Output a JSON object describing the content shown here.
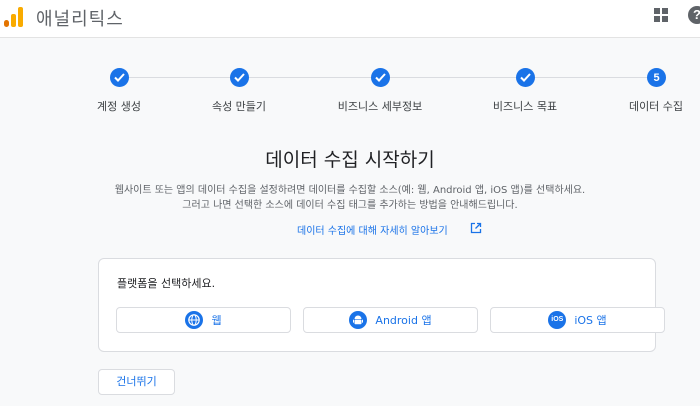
{
  "header": {
    "title": "애널리틱스",
    "logo_icon": "google-analytics-logo",
    "apps_icon": "apps-grid-icon",
    "help_icon": "help-icon"
  },
  "stepper": {
    "steps": [
      {
        "label": "계정 생성",
        "state": "done"
      },
      {
        "label": "속성 만들기",
        "state": "done"
      },
      {
        "label": "비즈니스 세부정보",
        "state": "done"
      },
      {
        "label": "비즈니스 목표",
        "state": "done"
      },
      {
        "label": "데이터 수집",
        "state": "current",
        "number": "5"
      }
    ]
  },
  "main": {
    "heading": "데이터 수집 시작하기",
    "description_line1": "웹사이트 또는 앱의 데이터 수집을 설정하려면 데이터를 수집할 소스(예: 웹, Android 앱, iOS 앱)를 선택하세요.",
    "description_line2": "그러고 나면 선택한 소스에 데이터 수집 태그를 추가하는 방법을 안내해드립니다.",
    "learn_more_link": "데이터 수집에 대해 자세히 알아보기"
  },
  "platform_card": {
    "title": "플랫폼을 선택하세요.",
    "buttons": [
      {
        "label": "웹",
        "icon": "globe-icon"
      },
      {
        "label": "Android 앱",
        "icon": "android-icon"
      },
      {
        "label": "iOS 앱",
        "icon": "ios-icon",
        "icon_text": "iOS"
      }
    ]
  },
  "footer": {
    "skip_label": "건너뛰기"
  },
  "colors": {
    "accent": "#1a73e8",
    "logo_orange": "#f9ab00",
    "logo_dark_orange": "#e37400"
  }
}
